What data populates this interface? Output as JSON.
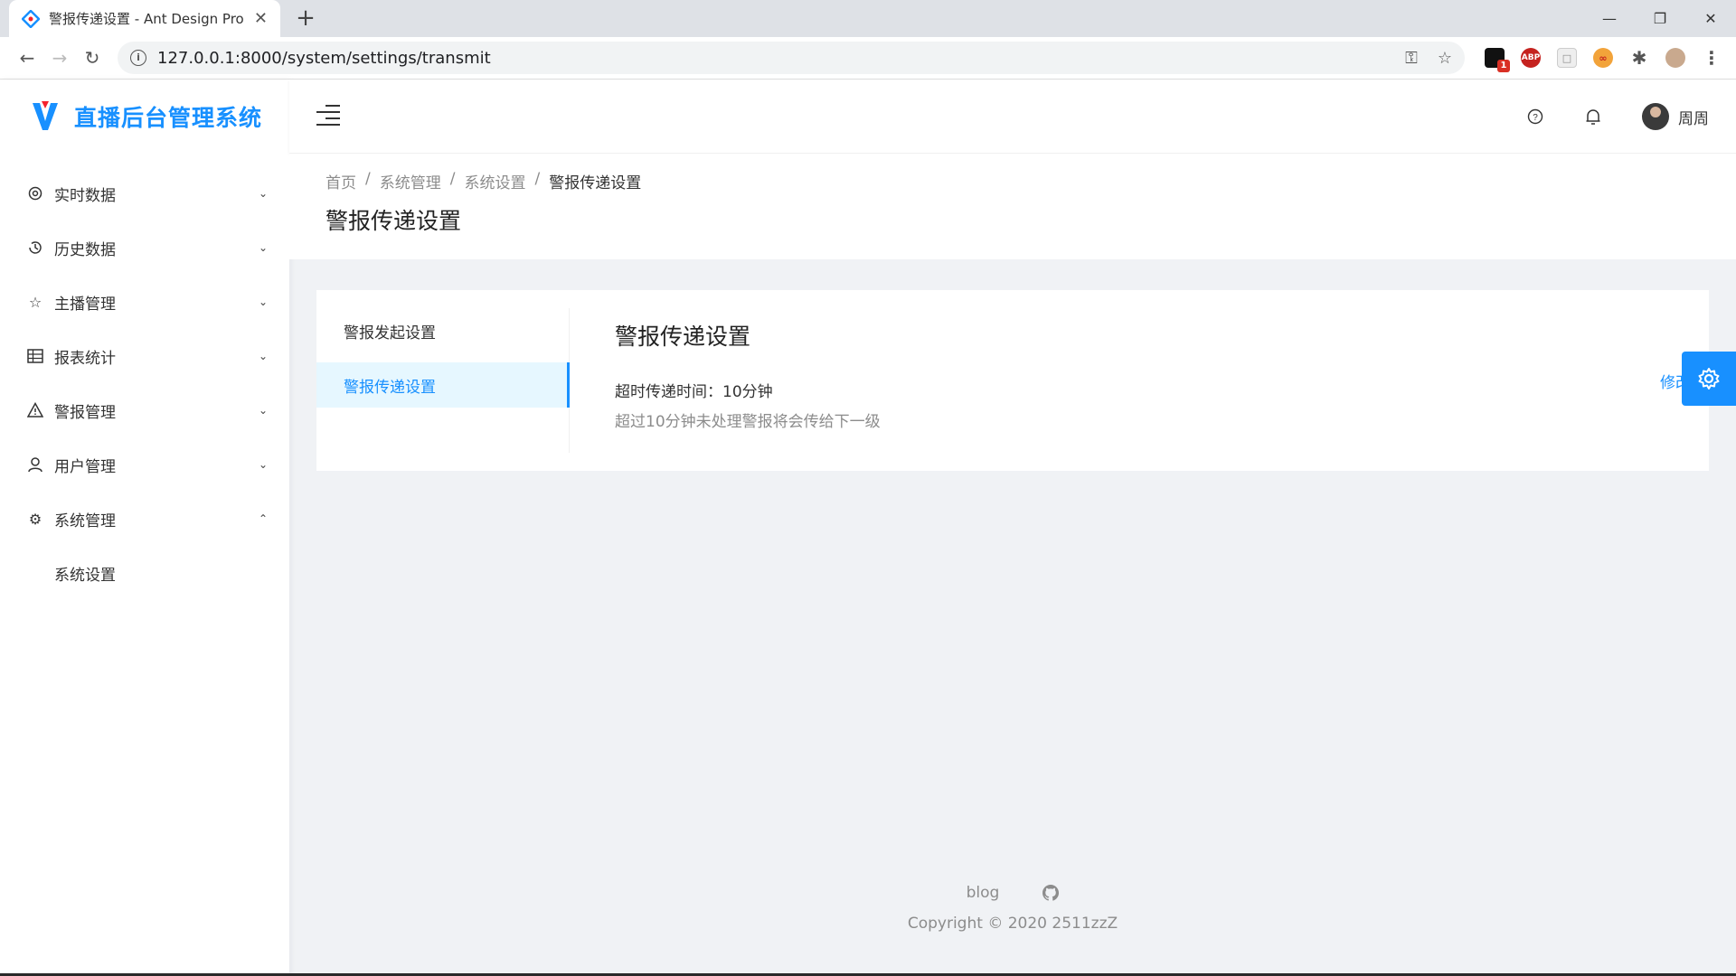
{
  "browser": {
    "tab_title": "警报传递设置 - Ant Design Pro",
    "url": "127.0.0.1:8000/system/settings/transmit",
    "extension_badge": "1",
    "abp_label": "ABP"
  },
  "app": {
    "logo_text": "直播后台管理系统",
    "menu": [
      {
        "label": "实时数据",
        "icon": "realtime-icon"
      },
      {
        "label": "历史数据",
        "icon": "history-icon"
      },
      {
        "label": "主播管理",
        "icon": "star-icon"
      },
      {
        "label": "报表统计",
        "icon": "table-icon"
      },
      {
        "label": "警报管理",
        "icon": "warning-icon"
      },
      {
        "label": "用户管理",
        "icon": "user-icon"
      },
      {
        "label": "系统管理",
        "icon": "setting-icon"
      }
    ],
    "submenu": {
      "label": "系统设置"
    },
    "user_name": "周周"
  },
  "breadcrumb": [
    "首页",
    "系统管理",
    "系统设置",
    "警报传递设置"
  ],
  "page_title": "警报传递设置",
  "card": {
    "menu": [
      "警报发起设置",
      "警报传递设置"
    ],
    "active_index": 1,
    "title": "警报传递设置",
    "line1": "超时传递时间：10分钟",
    "line2": "超过10分钟未处理警报将会传给下一级",
    "action": "修改"
  },
  "footer": {
    "link_blog": "blog",
    "copyright": "Copyright © 2020 2511zzZ"
  },
  "colors": {
    "primary": "#1890ff",
    "bg": "#f0f2f5"
  }
}
